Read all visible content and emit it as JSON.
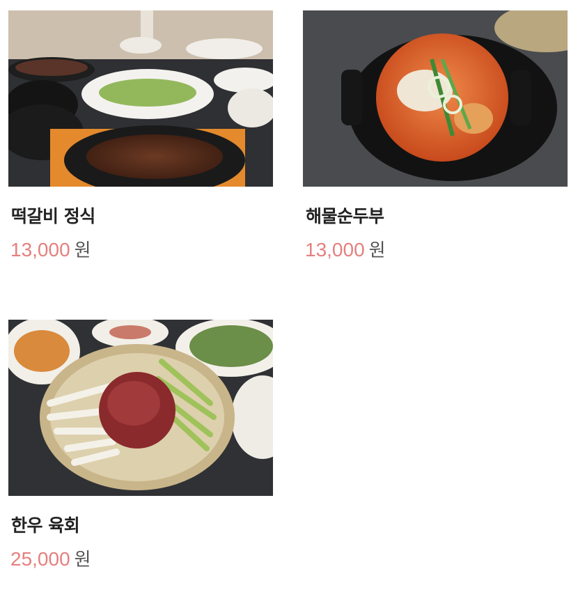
{
  "menu": {
    "items": [
      {
        "name": "떡갈비 정식",
        "price": "13,000",
        "currency": "원",
        "image_icon": "tteokgalbi-photo"
      },
      {
        "name": "해물순두부",
        "price": "13,000",
        "currency": "원",
        "image_icon": "seafood-soft-tofu-stew-photo"
      },
      {
        "name": "한우 육회",
        "price": "25,000",
        "currency": "원",
        "image_icon": "hanwoo-yukhoe-photo"
      }
    ]
  },
  "colors": {
    "price": "#e5807e",
    "title": "#222222",
    "currency": "#555555"
  }
}
